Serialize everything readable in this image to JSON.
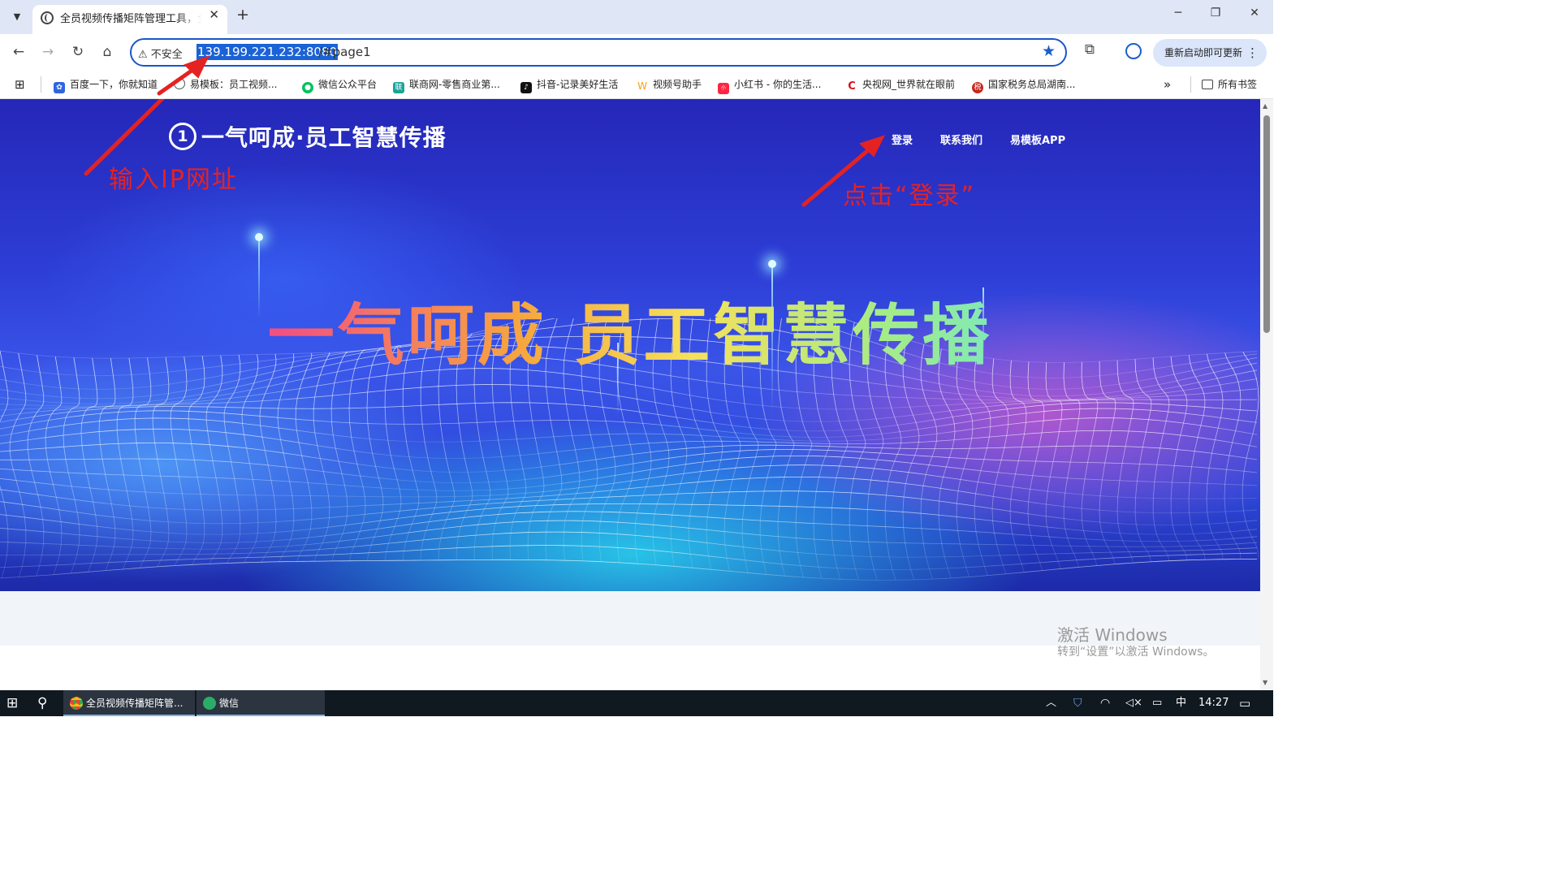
{
  "browser": {
    "tab_title": "全员视频传播矩阵管理工具，全",
    "tab_close": "✕",
    "new_tab": "+",
    "security_label": "不安全",
    "url_selected": "139.199.221.232:8080",
    "url_rest": "/#page1",
    "update_button": "重新启动即可更新",
    "update_menu": "⋮",
    "window_controls": {
      "minimize": "─",
      "restore": "❐",
      "close": "✕"
    }
  },
  "bookmarks": {
    "items": [
      {
        "label": "百度一下，你就知道",
        "icon": "baidu-paw-icon",
        "color": "#2f66e0"
      },
      {
        "label": "易模板：员工视频...",
        "icon": "globe-icon",
        "color": "#555555"
      },
      {
        "label": "微信公众平台",
        "icon": "wechat-icon",
        "color": "#07c160"
      },
      {
        "label": "联商网-零售商业第...",
        "icon": "linkshop-icon",
        "color": "#1aa39a"
      },
      {
        "label": "抖音-记录美好生活",
        "icon": "douyin-icon",
        "color": "#111111"
      },
      {
        "label": "视频号助手",
        "icon": "channels-icon",
        "color": "#f2a01b"
      },
      {
        "label": "小红书 - 你的生活...",
        "icon": "xiaohongshu-icon",
        "color": "#ff2442"
      },
      {
        "label": "央视网_世界就在眼前",
        "icon": "cctv-icon",
        "color": "#d6111a"
      },
      {
        "label": "国家税务总局湖南...",
        "icon": "tax-bureau-icon",
        "color": "#c8281e"
      }
    ],
    "more": "»",
    "all_bookmarks": "所有书签"
  },
  "site": {
    "logo_mark": "1",
    "logo_text": "一气呵成·员工智慧传播",
    "nav": {
      "login": "登录",
      "contact": "联系我们",
      "app": "易模板APP"
    },
    "headline": "一气呵成 员工智慧传播"
  },
  "annotations": {
    "enter_ip": "输入IP网址",
    "click_login": "点击“登录”",
    "arrow_color": "#e52222"
  },
  "watermark": {
    "line1": "激活 Windows",
    "line2": "转到“设置”以激活 Windows。"
  },
  "taskbar": {
    "chrome_app": "全员视频传播矩阵管...",
    "wechat_app": "微信",
    "ime": "中",
    "time": "14:27"
  }
}
